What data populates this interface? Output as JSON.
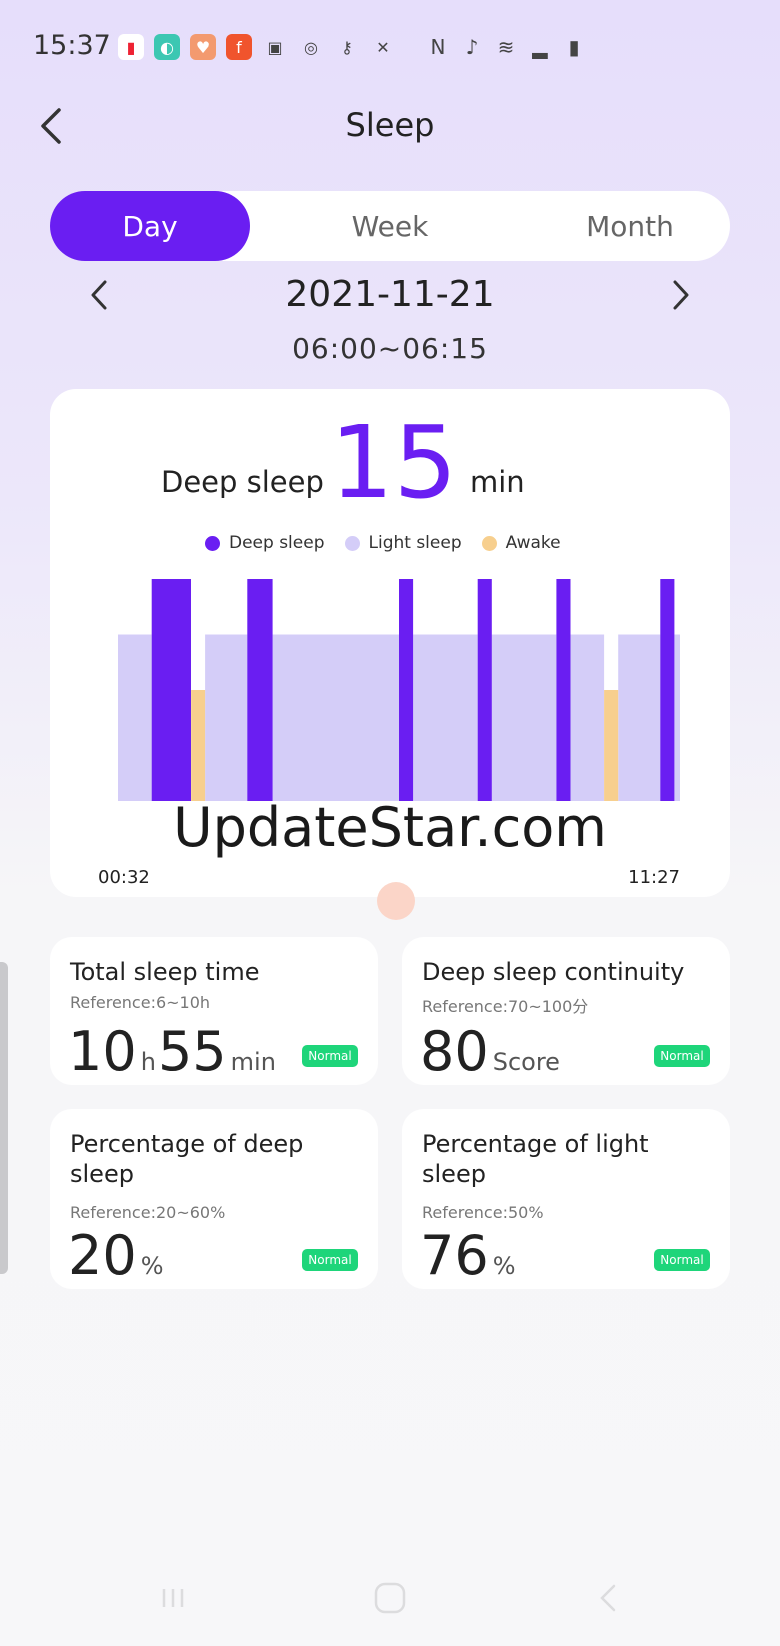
{
  "status_bar": {
    "time": "15:37",
    "left_icons": [
      {
        "name": "wallet-icon",
        "color": "#ffffff",
        "glyph": "▮"
      },
      {
        "name": "health-app-icon",
        "color": "#3cc7b2",
        "glyph": "◐"
      },
      {
        "name": "heart-rate-icon",
        "color": "#f39a6f",
        "glyph": "♥"
      },
      {
        "name": "flash-app-icon",
        "color": "#f0542d",
        "glyph": "f"
      },
      {
        "name": "gallery-icon",
        "color": "#444444",
        "glyph": "▣"
      },
      {
        "name": "chat-icon",
        "color": "#444444",
        "glyph": "◎"
      },
      {
        "name": "key-icon",
        "color": "#444444",
        "glyph": "⚷"
      },
      {
        "name": "close-box-icon",
        "color": "#444444",
        "glyph": "✕"
      }
    ],
    "right_icons": [
      {
        "name": "nfc-icon",
        "glyph": "Ν"
      },
      {
        "name": "mute-icon",
        "glyph": "♪"
      },
      {
        "name": "wifi-icon",
        "glyph": "≋"
      },
      {
        "name": "signal-icon",
        "glyph": "▂"
      },
      {
        "name": "battery-icon",
        "glyph": "▮"
      }
    ]
  },
  "header": {
    "title": "Sleep"
  },
  "tabs": [
    {
      "label": "Day",
      "active": true
    },
    {
      "label": "Week",
      "active": false
    },
    {
      "label": "Month",
      "active": false
    }
  ],
  "date": {
    "value": "2021-11-21",
    "range": "06:00~06:15"
  },
  "summary": {
    "label": "Deep sleep",
    "value": "15",
    "unit": "min"
  },
  "legend": [
    {
      "label": "Deep sleep",
      "color": "#6a1ef2"
    },
    {
      "label": "Light sleep",
      "color": "#d4cdf8"
    },
    {
      "label": "Awake",
      "color": "#f7cf8e"
    }
  ],
  "chart_data": {
    "type": "bar",
    "x_start": "00:32",
    "x_end": "11:27",
    "segments_description": "sleep stage timeline",
    "stages": [
      {
        "stage": "light",
        "start": 0.0,
        "end": 0.06
      },
      {
        "stage": "deep",
        "start": 0.06,
        "end": 0.13
      },
      {
        "stage": "awake",
        "start": 0.13,
        "end": 0.155
      },
      {
        "stage": "light",
        "start": 0.155,
        "end": 0.23
      },
      {
        "stage": "deep",
        "start": 0.23,
        "end": 0.275
      },
      {
        "stage": "light",
        "start": 0.275,
        "end": 0.5
      },
      {
        "stage": "deep",
        "start": 0.5,
        "end": 0.525
      },
      {
        "stage": "light",
        "start": 0.525,
        "end": 0.64
      },
      {
        "stage": "deep",
        "start": 0.64,
        "end": 0.665
      },
      {
        "stage": "light",
        "start": 0.665,
        "end": 0.78
      },
      {
        "stage": "deep",
        "start": 0.78,
        "end": 0.805
      },
      {
        "stage": "light",
        "start": 0.805,
        "end": 0.865
      },
      {
        "stage": "awake",
        "start": 0.865,
        "end": 0.89
      },
      {
        "stage": "light",
        "start": 0.89,
        "end": 0.965
      },
      {
        "stage": "deep",
        "start": 0.965,
        "end": 0.99
      },
      {
        "stage": "light",
        "start": 0.99,
        "end": 1.0
      }
    ],
    "stage_levels": {
      "deep": 1.0,
      "light": 0.75,
      "awake": 0.5
    }
  },
  "watermark": "UpdateStar.com",
  "stats": [
    {
      "title": "Total sleep time",
      "reference": "Reference:6~10h",
      "values": [
        {
          "num": "10",
          "unit": "h"
        },
        {
          "num": "55",
          "unit": "min"
        }
      ],
      "badge": "Normal"
    },
    {
      "title": "Deep sleep continuity",
      "reference": "Reference:70~100分",
      "values": [
        {
          "num": "80",
          "unit": "Score"
        }
      ],
      "badge": "Normal"
    },
    {
      "title": "Percentage of deep sleep",
      "reference": "Reference:20~60%",
      "values": [
        {
          "num": "20",
          "unit": "%"
        }
      ],
      "badge": "Normal"
    },
    {
      "title": "Percentage of light sleep",
      "reference": "Reference:50%",
      "values": [
        {
          "num": "76",
          "unit": "%"
        }
      ],
      "badge": "Normal"
    }
  ]
}
